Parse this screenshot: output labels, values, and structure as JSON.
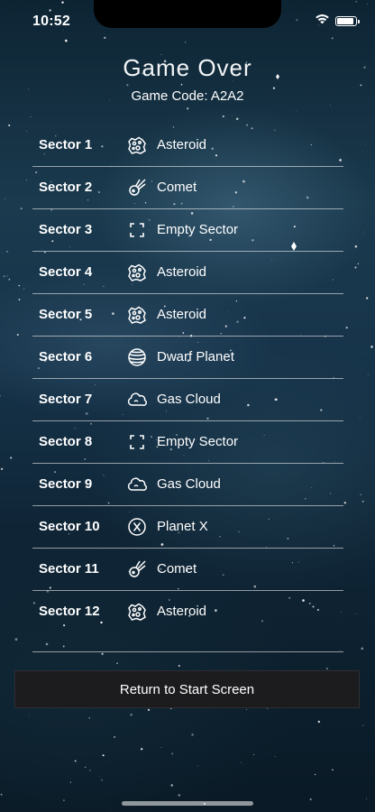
{
  "status_bar": {
    "time": "10:52",
    "battery_level": 0.95
  },
  "header": {
    "title": "Game Over",
    "game_code": "Game Code: A2A2"
  },
  "sectors": [
    {
      "sector": "Sector 1",
      "icon": "asteroid-icon",
      "result": "Asteroid"
    },
    {
      "sector": "Sector 2",
      "icon": "comet-icon",
      "result": "Comet"
    },
    {
      "sector": "Sector 3",
      "icon": "empty-sector-icon",
      "result": "Empty Sector"
    },
    {
      "sector": "Sector 4",
      "icon": "asteroid-icon",
      "result": "Asteroid"
    },
    {
      "sector": "Sector 5",
      "icon": "asteroid-icon",
      "result": "Asteroid"
    },
    {
      "sector": "Sector 6",
      "icon": "dwarf-planet-icon",
      "result": "Dwarf Planet"
    },
    {
      "sector": "Sector 7",
      "icon": "gas-cloud-icon",
      "result": "Gas Cloud"
    },
    {
      "sector": "Sector 8",
      "icon": "empty-sector-icon",
      "result": "Empty Sector"
    },
    {
      "sector": "Sector 9",
      "icon": "gas-cloud-icon",
      "result": "Gas Cloud"
    },
    {
      "sector": "Sector 10",
      "icon": "planet-x-icon",
      "result": "Planet X"
    },
    {
      "sector": "Sector 11",
      "icon": "comet-icon",
      "result": "Comet"
    },
    {
      "sector": "Sector 12",
      "icon": "asteroid-icon",
      "result": "Asteroid"
    }
  ],
  "actions": {
    "return_label": "Return to Start Screen"
  },
  "colors": {
    "button_bg": "#1c1c1e",
    "divider": "#ffffff",
    "text": "#ffffff"
  }
}
